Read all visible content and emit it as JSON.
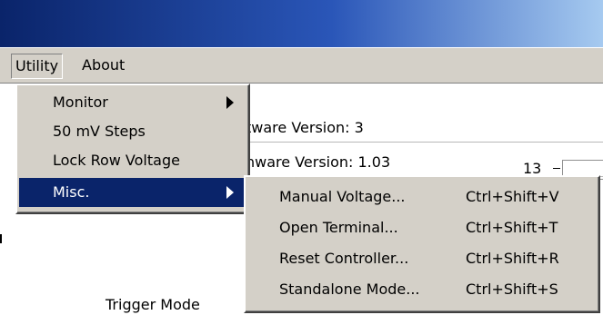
{
  "menubar": {
    "utility": "Utility",
    "about": "About"
  },
  "utility_menu": {
    "items": [
      {
        "label": "Monitor",
        "submenu": true
      },
      {
        "label": "50 mV Steps",
        "submenu": false
      },
      {
        "label": "Lock Row Voltage",
        "submenu": false
      },
      {
        "label": "Misc.",
        "submenu": true,
        "selected": true
      }
    ]
  },
  "misc_menu": {
    "items": [
      {
        "label": "Manual Voltage...",
        "shortcut": "Ctrl+Shift+V"
      },
      {
        "label": "Open Terminal...",
        "shortcut": "Ctrl+Shift+T"
      },
      {
        "label": "Reset Controller...",
        "shortcut": "Ctrl+Shift+R"
      },
      {
        "label": "Standalone Mode...",
        "shortcut": "Ctrl+Shift+S"
      }
    ]
  },
  "content": {
    "line1": "tware Version: 3",
    "line2": "nware Version: 1.03",
    "tick_label": "13",
    "trigger_mode": "Trigger Mode"
  },
  "colors": {
    "menu_bg": "#d4d0c8",
    "highlight": "#0a246a",
    "titlebar_start": "#0a246a",
    "titlebar_end": "#a6caf0"
  }
}
